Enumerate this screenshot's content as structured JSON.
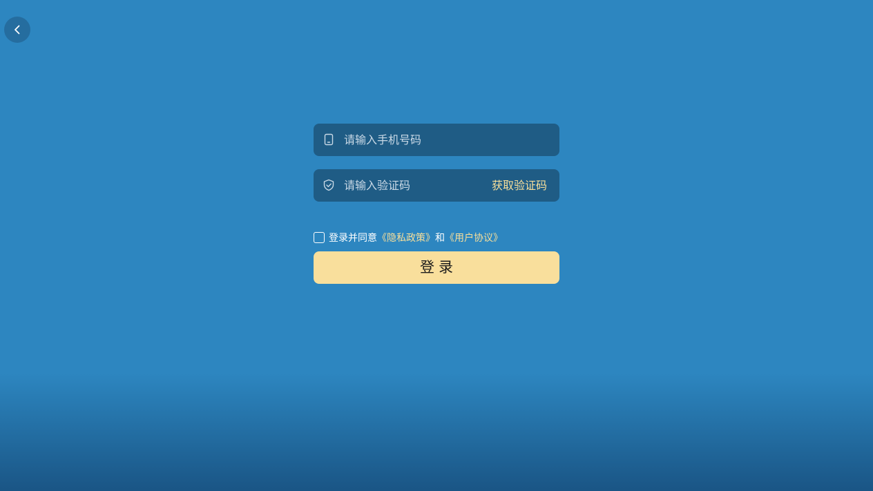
{
  "nav": {
    "back_icon": "chevron-left-icon"
  },
  "form": {
    "phone": {
      "icon": "phone-icon",
      "placeholder": "请输入手机号码",
      "value": ""
    },
    "code": {
      "icon": "shield-check-icon",
      "placeholder": "请输入验证码",
      "value": "",
      "get_code_label": "获取验证码"
    },
    "agreement": {
      "checked": false,
      "prefix": "登录并同意",
      "privacy_link": "《隐私政策》",
      "conjunction": "和",
      "terms_link": "《用户协议》"
    },
    "login_label": "登录"
  },
  "colors": {
    "background": "#2d86c0",
    "field_background": "#1f5c85",
    "accent": "#f8df9a",
    "button_background": "#f9df9c"
  }
}
